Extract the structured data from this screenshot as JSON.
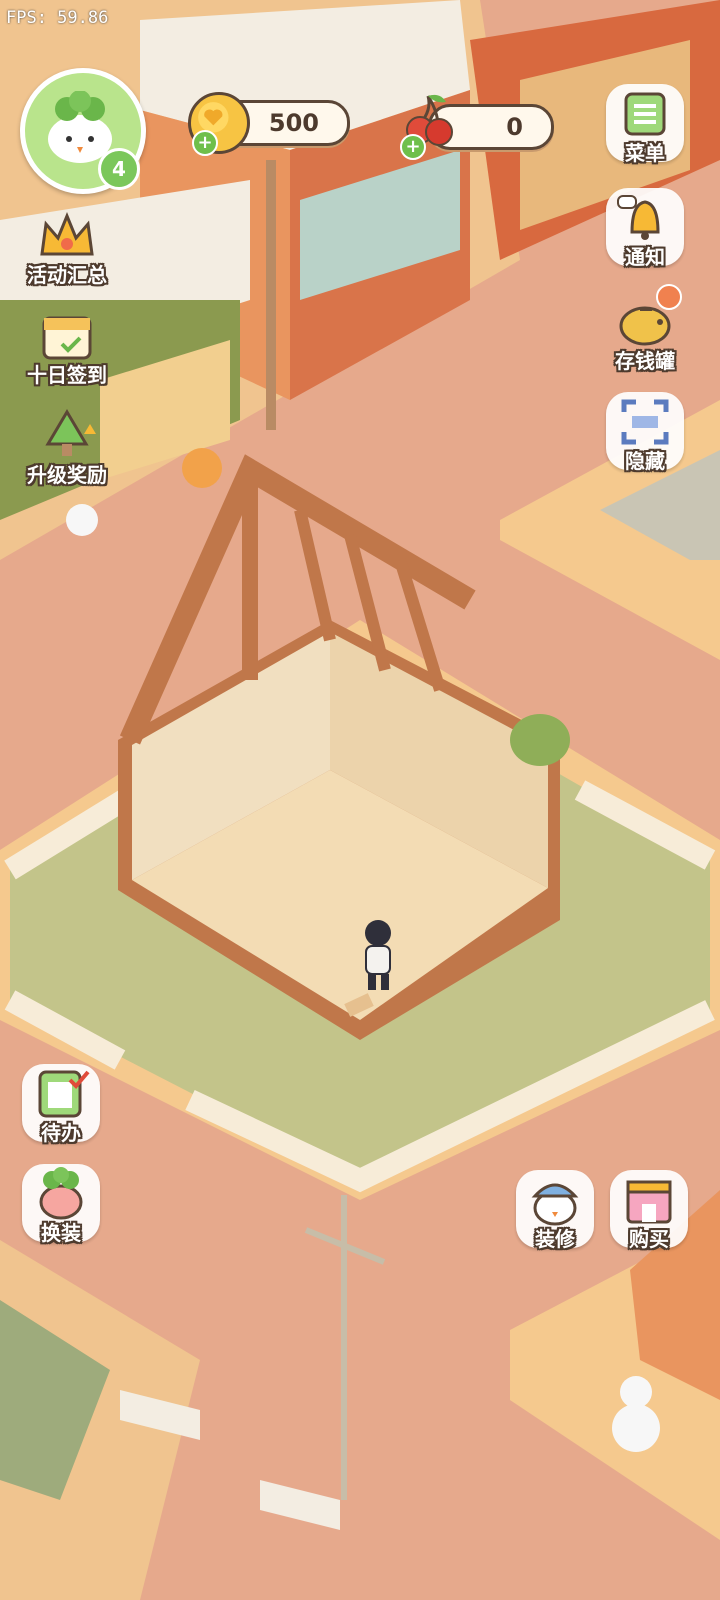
{
  "hud": {
    "fps_text": "FPS: 59.86",
    "player_level": "4",
    "coins": "500",
    "cherries": "0"
  },
  "left_menu": [
    {
      "label": "活动汇总",
      "icon": "crown-icon"
    },
    {
      "label": "十日签到",
      "icon": "calendar-gift-icon"
    },
    {
      "label": "升级奖励",
      "icon": "tree-upgrade-icon"
    }
  ],
  "right_menu": [
    {
      "label": "菜单",
      "icon": "menu-list-icon"
    },
    {
      "label": "通知",
      "icon": "bell-icon"
    },
    {
      "label": "存钱罐",
      "icon": "piggy-bank-icon"
    },
    {
      "label": "隐藏",
      "icon": "hide-frame-icon"
    }
  ],
  "bottom_left": [
    {
      "label": "待办",
      "icon": "todo-checklist-icon"
    },
    {
      "label": "换装",
      "icon": "dress-up-icon"
    }
  ],
  "bottom_right": [
    {
      "label": "装修",
      "icon": "renovate-icon"
    },
    {
      "label": "购买",
      "icon": "shop-icon"
    }
  ],
  "colors": {
    "road": "#e6a98c",
    "sidewalk": "#f5c98e",
    "grass": "#c3c48a",
    "wood": "#c0774a",
    "floor": "#f3dcb4",
    "outline": "#4d3a2d"
  }
}
